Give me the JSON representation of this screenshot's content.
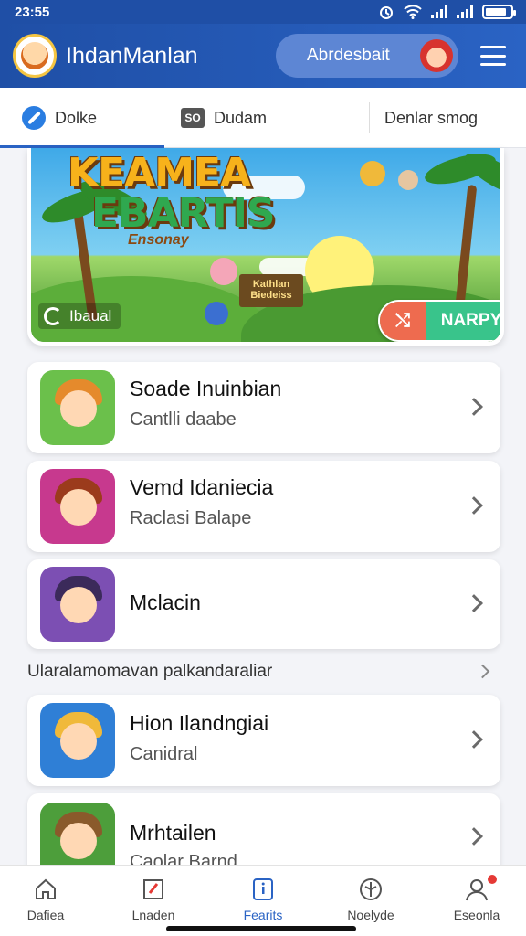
{
  "status_bar": {
    "time": "23:55",
    "battery_level": 0.85
  },
  "header": {
    "app_title": "IhdanManlan",
    "pill_label": "Abrdesbait"
  },
  "tabs": [
    {
      "label": "Dolke",
      "icon": "pencil-icon",
      "active": true
    },
    {
      "label": "Dudam",
      "icon": "so-badge-icon",
      "icon_text": "SO",
      "active": false
    },
    {
      "label": "Denlar smog",
      "active": false
    }
  ],
  "banner": {
    "title_line1": "KEAMEA",
    "title_line2": "EBARTIS",
    "subtitle": "Ensonay",
    "sign_text": "Kathlan Biedeiss",
    "label": "Ibaual",
    "cta_icon_text": "⤭",
    "cta_label": "NARPY"
  },
  "list": [
    {
      "title": "Soade Inuinbian",
      "subtitle": "Cantlli daabe",
      "thumb_bg": "#6bc04b",
      "hair": "#e58a2c"
    },
    {
      "title": "Vemd Idaniecia",
      "subtitle": "Raclasi Balape",
      "thumb_bg": "#c7398e",
      "hair": "#9b3b1c"
    },
    {
      "title": "Mclacin",
      "subtitle": "",
      "thumb_bg": "#7c4fb3",
      "hair": "#3b2a5a"
    }
  ],
  "section": {
    "label": "Ularalamomavan palkandaraliar"
  },
  "list2": [
    {
      "title": "Hion Ilandngiai",
      "subtitle": "Canidral",
      "thumb_bg": "#2f7fd6",
      "hair": "#f0b93a"
    },
    {
      "title": "Mrhtailen",
      "subtitle": "Caolar Barnd",
      "thumb_bg": "#4d9e3b",
      "hair": "#8a5a2b"
    }
  ],
  "bottom_nav": [
    {
      "label": "Dafiea",
      "icon": "home-icon",
      "active": false
    },
    {
      "label": "Lnaden",
      "icon": "edit-flag-icon",
      "active": false
    },
    {
      "label": "Fearits",
      "icon": "info-square-icon",
      "active": true
    },
    {
      "label": "Noelyde",
      "icon": "compass-icon",
      "active": false
    },
    {
      "label": "Eseonla",
      "icon": "profile-icon",
      "active": false,
      "badge": true
    }
  ],
  "colors": {
    "primary": "#2a63c4",
    "header": "#1f4fa6",
    "cta_green": "#39c48b",
    "cta_red": "#ee6b4f"
  }
}
